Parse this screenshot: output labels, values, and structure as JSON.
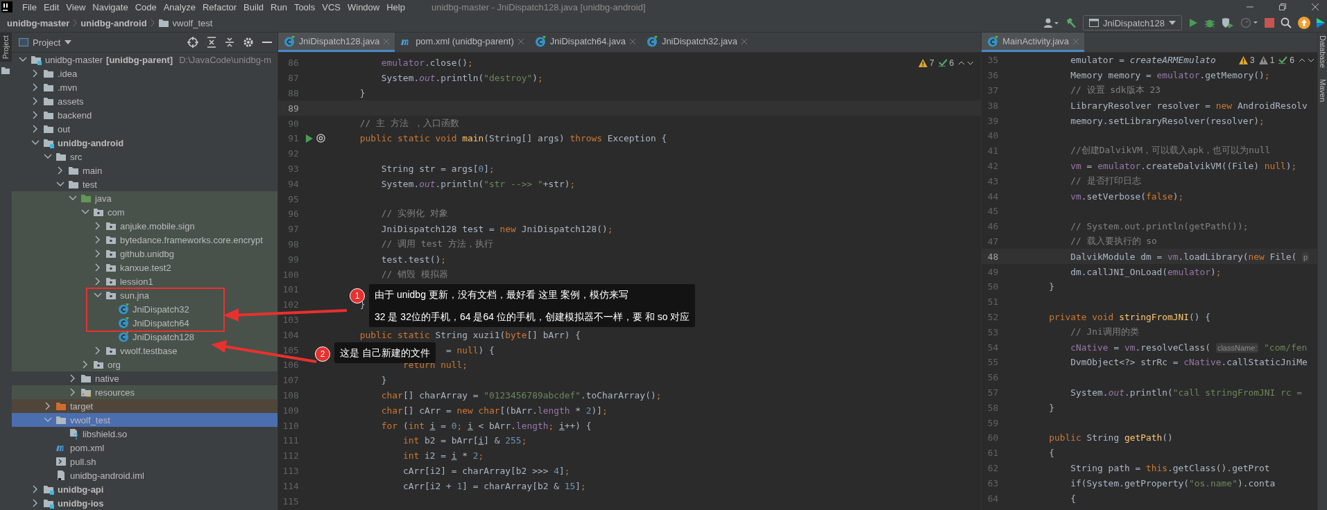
{
  "window": {
    "title": "unidbg-master - JniDispatch128.java [unidbg-android]",
    "menu": [
      "File",
      "Edit",
      "View",
      "Navigate",
      "Code",
      "Analyze",
      "Refactor",
      "Build",
      "Run",
      "Tools",
      "VCS",
      "Window",
      "Help"
    ]
  },
  "breadcrumbs": [
    {
      "label": "unidbg-master",
      "kind": "module"
    },
    {
      "label": "unidbg-android",
      "kind": "module"
    },
    {
      "label": "vwolf_test",
      "kind": "folder"
    }
  ],
  "toolbar": {
    "run_configuration": "JniDispatch128"
  },
  "side_tabs": {
    "left": [
      {
        "label": "Project",
        "selected": true
      }
    ],
    "right": [
      {
        "label": "Database",
        "selected": false
      },
      {
        "label": "Maven",
        "selected": false
      }
    ]
  },
  "project_panel": {
    "title": "Project",
    "tree": [
      {
        "name": "unidbg-master",
        "module_label": "[unidbg-parent]",
        "path": "D:\\JavaCode\\unidbg-m",
        "kind": "module",
        "bold": false,
        "expanded": true,
        "selected": false,
        "children": [
          {
            "name": ".idea",
            "kind": "folder",
            "expanded": false,
            "selected": false
          },
          {
            "name": ".mvn",
            "kind": "folder",
            "expanded": false,
            "selected": false
          },
          {
            "name": "assets",
            "kind": "folder",
            "expanded": false,
            "selected": false
          },
          {
            "name": "backend",
            "kind": "folder",
            "expanded": false,
            "selected": false
          },
          {
            "name": "out",
            "kind": "folder",
            "expanded": false,
            "selected": false
          },
          {
            "name": "unidbg-android",
            "kind": "module",
            "bold": true,
            "expanded": true,
            "selected": false,
            "children": [
              {
                "name": "src",
                "kind": "folder",
                "expanded": true,
                "selected": false,
                "children": [
                  {
                    "name": "main",
                    "kind": "folder",
                    "expanded": false,
                    "selected": false
                  },
                  {
                    "name": "test",
                    "kind": "folder",
                    "expanded": true,
                    "selected": false,
                    "children": [
                      {
                        "name": "java",
                        "kind": "test-source",
                        "expanded": true,
                        "selected": false,
                        "children": [
                          {
                            "name": "com",
                            "kind": "package",
                            "expanded": true,
                            "selected": false,
                            "children": [
                              {
                                "name": "anjuke.mobile.sign",
                                "kind": "package",
                                "expanded": false,
                                "selected": false
                              },
                              {
                                "name": "bytedance.frameworks.core.encrypt",
                                "kind": "package",
                                "expanded": false,
                                "selected": false
                              },
                              {
                                "name": "github.unidbg",
                                "kind": "package",
                                "expanded": false,
                                "selected": false
                              },
                              {
                                "name": "kanxue.test2",
                                "kind": "package",
                                "expanded": false,
                                "selected": false
                              },
                              {
                                "name": "lession1",
                                "kind": "package",
                                "expanded": false,
                                "selected": false
                              },
                              {
                                "name": "sun.jna",
                                "kind": "package",
                                "expanded": true,
                                "selected": false,
                                "children": [
                                  {
                                    "name": "JniDispatch32",
                                    "kind": "class",
                                    "selected": false
                                  },
                                  {
                                    "name": "JniDispatch64",
                                    "kind": "class",
                                    "selected": false
                                  },
                                  {
                                    "name": "JniDispatch128",
                                    "kind": "class",
                                    "selected": false
                                  }
                                ]
                              },
                              {
                                "name": "vwolf.testbase",
                                "kind": "package",
                                "expanded": false,
                                "selected": false
                              }
                            ]
                          },
                          {
                            "name": "org",
                            "kind": "package",
                            "expanded": false,
                            "selected": false
                          }
                        ]
                      },
                      {
                        "name": "native",
                        "kind": "folder",
                        "expanded": false,
                        "selected": false
                      },
                      {
                        "name": "resources",
                        "kind": "resources",
                        "expanded": false,
                        "selected": false
                      }
                    ]
                  }
                ]
              },
              {
                "name": "target",
                "kind": "excluded",
                "expanded": false,
                "selected": false
              },
              {
                "name": "vwolf_test",
                "kind": "folder",
                "expanded": true,
                "selected": true,
                "children": [
                  {
                    "name": "libshield.so",
                    "kind": "unknown-file",
                    "selected": false
                  }
                ]
              },
              {
                "name": "pom.xml",
                "kind": "maven",
                "selected": false
              },
              {
                "name": "pull.sh",
                "kind": "shell",
                "selected": false
              },
              {
                "name": "unidbg-android.iml",
                "kind": "iml",
                "selected": false
              }
            ]
          },
          {
            "name": "unidbg-api",
            "kind": "module",
            "bold": true,
            "expanded": false,
            "selected": false
          },
          {
            "name": "unidbg-ios",
            "kind": "module",
            "bold": true,
            "expanded": false,
            "selected": false
          }
        ]
      }
    ]
  },
  "editors": [
    {
      "tabs": [
        {
          "label": "JniDispatch128.java",
          "kind": "class",
          "selected": true
        },
        {
          "label": "pom.xml (unidbg-parent)",
          "kind": "maven",
          "selected": false
        },
        {
          "label": "JniDispatch64.java",
          "kind": "class",
          "selected": false
        },
        {
          "label": "JniDispatch32.java",
          "kind": "class",
          "selected": false
        }
      ],
      "inspections": [
        {
          "kind": "warning",
          "count": "7"
        },
        {
          "kind": "typo",
          "count": "6"
        }
      ],
      "lines": [
        {
          "n": "86",
          "current": false,
          "tokens": [
            {
              "kind": "field",
              "text": "    emulator"
            },
            {
              "kind": "plain",
              "text": ".close()"
            },
            {
              "kind": "keyword",
              "text": ";"
            }
          ]
        },
        {
          "n": "87",
          "current": false,
          "tokens": [
            {
              "kind": "plain",
              "text": "    System."
            },
            {
              "kind": "static",
              "text": "out"
            },
            {
              "kind": "plain",
              "text": ".println("
            },
            {
              "kind": "string",
              "text": "\"destroy\""
            },
            {
              "kind": "plain",
              "text": ")"
            },
            {
              "kind": "keyword",
              "text": ";"
            }
          ]
        },
        {
          "n": "88",
          "current": false,
          "tokens": [
            {
              "kind": "plain",
              "text": "}"
            }
          ]
        },
        {
          "n": "89",
          "current": true
        },
        {
          "n": "90",
          "current": false,
          "tokens": [
            {
              "kind": "comment",
              "text": "// 主 方法 ，入口函数"
            }
          ]
        },
        {
          "n": "91",
          "current": false,
          "kind": "entry-point",
          "tokens": [
            {
              "kind": "keyword",
              "text": "public static void "
            },
            {
              "kind": "method",
              "text": "main"
            },
            {
              "kind": "plain",
              "text": "(String[] args) "
            },
            {
              "kind": "keyword",
              "text": "throws "
            },
            {
              "kind": "plain",
              "text": "Exception {"
            }
          ]
        },
        {
          "n": "92",
          "current": false
        },
        {
          "n": "93",
          "current": false,
          "tokens": [
            {
              "kind": "plain",
              "text": "    String str = args["
            },
            {
              "kind": "number",
              "text": "0"
            },
            {
              "kind": "plain",
              "text": "]"
            },
            {
              "kind": "keyword",
              "text": ";"
            }
          ]
        },
        {
          "n": "94",
          "current": false,
          "tokens": [
            {
              "kind": "plain",
              "text": "    System."
            },
            {
              "kind": "static",
              "text": "out"
            },
            {
              "kind": "plain",
              "text": ".println("
            },
            {
              "kind": "string",
              "text": "\"str -->> \""
            },
            {
              "kind": "plain",
              "text": "+str)"
            },
            {
              "kind": "keyword",
              "text": ";"
            }
          ]
        },
        {
          "n": "95",
          "current": false
        },
        {
          "n": "96",
          "current": false,
          "tokens": [
            {
              "kind": "comment",
              "text": "    // 实例化 对象"
            }
          ]
        },
        {
          "n": "97",
          "current": false,
          "tokens": [
            {
              "kind": "plain",
              "text": "    JniDispatch128 test = "
            },
            {
              "kind": "keyword",
              "text": "new "
            },
            {
              "kind": "plain",
              "text": "JniDispatch128()"
            },
            {
              "kind": "keyword",
              "text": ";"
            }
          ]
        },
        {
          "n": "98",
          "current": false,
          "tokens": [
            {
              "kind": "comment",
              "text": "    // 调用 test 方法，执行"
            }
          ]
        },
        {
          "n": "99",
          "current": false,
          "tokens": [
            {
              "kind": "plain",
              "text": "    test.test()"
            },
            {
              "kind": "keyword",
              "text": ";"
            }
          ]
        },
        {
          "n": "100",
          "current": false,
          "tokens": [
            {
              "kind": "comment",
              "text": "    // 销毁 模拟器"
            }
          ]
        },
        {
          "n": "101",
          "current": false
        },
        {
          "n": "102",
          "current": false,
          "tokens": [
            {
              "kind": "plain",
              "text": "}"
            }
          ]
        },
        {
          "n": "103",
          "current": false
        },
        {
          "n": "104",
          "current": false,
          "tokens": [
            {
              "kind": "keyword",
              "text": "public static "
            },
            {
              "kind": "plain",
              "text": "String xuzi1("
            },
            {
              "kind": "keyword",
              "text": "byte"
            },
            {
              "kind": "plain",
              "text": "[] bArr) {"
            }
          ]
        },
        {
          "n": "105",
          "current": false,
          "tokens": [
            {
              "kind": "plain",
              "text": "                = "
            },
            {
              "kind": "keyword",
              "text": "null"
            },
            {
              "kind": "plain",
              "text": ") {"
            }
          ]
        },
        {
          "n": "106",
          "current": false,
          "tokens": [
            {
              "kind": "keyword",
              "text": "        return null;"
            }
          ]
        },
        {
          "n": "107",
          "current": false,
          "tokens": [
            {
              "kind": "plain",
              "text": "    }"
            }
          ]
        },
        {
          "n": "108",
          "current": false,
          "tokens": [
            {
              "kind": "keyword",
              "text": "    char"
            },
            {
              "kind": "plain",
              "text": "[] charArray = "
            },
            {
              "kind": "string",
              "text": "\"0123456789abcdef\""
            },
            {
              "kind": "plain",
              "text": ".toCharArray()"
            },
            {
              "kind": "keyword",
              "text": ";"
            }
          ]
        },
        {
          "n": "109",
          "current": false,
          "tokens": [
            {
              "kind": "keyword",
              "text": "    char"
            },
            {
              "kind": "plain",
              "text": "[] cArr = "
            },
            {
              "kind": "keyword",
              "text": "new char"
            },
            {
              "kind": "plain",
              "text": "[(bArr."
            },
            {
              "kind": "field",
              "text": "length"
            },
            {
              "kind": "plain",
              "text": " * "
            },
            {
              "kind": "number",
              "text": "2"
            },
            {
              "kind": "plain",
              "text": ")]"
            },
            {
              "kind": "keyword",
              "text": ";"
            }
          ]
        },
        {
          "n": "110",
          "current": false,
          "tokens": [
            {
              "kind": "keyword",
              "text": "    for "
            },
            {
              "kind": "plain",
              "text": "("
            },
            {
              "kind": "keyword",
              "text": "int "
            },
            {
              "kind": "variable",
              "text": "i"
            },
            {
              "kind": "plain",
              "text": " = "
            },
            {
              "kind": "number",
              "text": "0"
            },
            {
              "kind": "keyword",
              "text": "; "
            },
            {
              "kind": "variable",
              "text": "i"
            },
            {
              "kind": "plain",
              "text": " < bArr."
            },
            {
              "kind": "field",
              "text": "length"
            },
            {
              "kind": "keyword",
              "text": "; "
            },
            {
              "kind": "variable",
              "text": "i"
            },
            {
              "kind": "plain",
              "text": "++) {"
            }
          ]
        },
        {
          "n": "111",
          "current": false,
          "tokens": [
            {
              "kind": "keyword",
              "text": "        int "
            },
            {
              "kind": "plain",
              "text": "b2 = bArr["
            },
            {
              "kind": "variable",
              "text": "i"
            },
            {
              "kind": "plain",
              "text": "] & "
            },
            {
              "kind": "number",
              "text": "255"
            },
            {
              "kind": "keyword",
              "text": ";"
            }
          ]
        },
        {
          "n": "112",
          "current": false,
          "tokens": [
            {
              "kind": "keyword",
              "text": "        int "
            },
            {
              "kind": "plain",
              "text": "i2 = "
            },
            {
              "kind": "variable",
              "text": "i"
            },
            {
              "kind": "plain",
              "text": " * "
            },
            {
              "kind": "number",
              "text": "2"
            },
            {
              "kind": "keyword",
              "text": ";"
            }
          ]
        },
        {
          "n": "113",
          "current": false,
          "tokens": [
            {
              "kind": "plain",
              "text": "        cArr[i2] = charArray[b2 >>> "
            },
            {
              "kind": "number",
              "text": "4"
            },
            {
              "kind": "plain",
              "text": "]"
            },
            {
              "kind": "keyword",
              "text": ";"
            }
          ]
        },
        {
          "n": "114",
          "current": false,
          "tokens": [
            {
              "kind": "plain",
              "text": "        cArr[i2 + "
            },
            {
              "kind": "number",
              "text": "1"
            },
            {
              "kind": "plain",
              "text": "] = charArray[b2 & "
            },
            {
              "kind": "number",
              "text": "15"
            },
            {
              "kind": "plain",
              "text": "]"
            },
            {
              "kind": "keyword",
              "text": ";"
            }
          ]
        },
        {
          "n": "115",
          "current": false
        }
      ]
    },
    {
      "tabs": [
        {
          "label": "MainActivity.java",
          "kind": "class",
          "selected": true
        }
      ],
      "inspections": [
        {
          "kind": "warning",
          "count": "3"
        },
        {
          "kind": "weak-warning",
          "count": "1"
        },
        {
          "kind": "typo",
          "count": "6"
        }
      ],
      "lines": [
        {
          "n": "35",
          "current": false,
          "tokens": [
            {
              "kind": "plain",
              "text": "    emulator = "
            },
            {
              "kind": "italic",
              "text": "createARMEmulato"
            }
          ]
        },
        {
          "n": "36",
          "current": false,
          "tokens": [
            {
              "kind": "plain",
              "text": "    Memory memory = "
            },
            {
              "kind": "field",
              "text": "emulator"
            },
            {
              "kind": "plain",
              "text": ".getMemory()"
            },
            {
              "kind": "keyword",
              "text": ";"
            }
          ]
        },
        {
          "n": "37",
          "current": false,
          "tokens": [
            {
              "kind": "comment",
              "text": "    // 设置 sdk版本 23"
            }
          ]
        },
        {
          "n": "38",
          "current": false,
          "tokens": [
            {
              "kind": "plain",
              "text": "    LibraryResolver resolver = "
            },
            {
              "kind": "keyword",
              "text": "new "
            },
            {
              "kind": "plain",
              "text": "AndroidResolv"
            }
          ]
        },
        {
          "n": "39",
          "current": false,
          "tokens": [
            {
              "kind": "plain",
              "text": "    memory.setLibraryResolver(resolver)"
            },
            {
              "kind": "keyword",
              "text": ";"
            }
          ]
        },
        {
          "n": "40",
          "current": false
        },
        {
          "n": "41",
          "current": false,
          "tokens": [
            {
              "kind": "comment",
              "text": "    //创建DalvikVM，可以载入apk，也可以为null"
            }
          ]
        },
        {
          "n": "42",
          "current": false,
          "tokens": [
            {
              "kind": "field",
              "text": "    vm"
            },
            {
              "kind": "plain",
              "text": " = "
            },
            {
              "kind": "field",
              "text": "emulator"
            },
            {
              "kind": "plain",
              "text": ".createDalvikVM((File) "
            },
            {
              "kind": "keyword",
              "text": "null"
            },
            {
              "kind": "plain",
              "text": ")"
            },
            {
              "kind": "keyword",
              "text": ";"
            }
          ]
        },
        {
          "n": "43",
          "current": false,
          "tokens": [
            {
              "kind": "comment",
              "text": "    // 是否打印日志"
            }
          ]
        },
        {
          "n": "44",
          "current": false,
          "tokens": [
            {
              "kind": "field",
              "text": "    vm"
            },
            {
              "kind": "plain",
              "text": ".setVerbose("
            },
            {
              "kind": "keyword",
              "text": "false"
            },
            {
              "kind": "plain",
              "text": ")"
            },
            {
              "kind": "keyword",
              "text": ";"
            }
          ]
        },
        {
          "n": "45",
          "current": false
        },
        {
          "n": "46",
          "current": false,
          "tokens": [
            {
              "kind": "comment",
              "text": "    // System.out.println(getPath());"
            }
          ]
        },
        {
          "n": "47",
          "current": false,
          "tokens": [
            {
              "kind": "comment",
              "text": "    // 载入要执行的 so"
            }
          ]
        },
        {
          "n": "48",
          "current": true,
          "tokens": [
            {
              "kind": "plain",
              "text": "    DalvikModule dm = "
            },
            {
              "kind": "field",
              "text": "vm"
            },
            {
              "kind": "plain",
              "text": ".loadLibrary("
            },
            {
              "kind": "keyword",
              "text": "new "
            },
            {
              "kind": "plain",
              "text": "File( "
            },
            {
              "kind": "hint",
              "text": "p"
            }
          ]
        },
        {
          "n": "49",
          "current": false,
          "tokens": [
            {
              "kind": "plain",
              "text": "    dm.callJNI_OnLoad("
            },
            {
              "kind": "field",
              "text": "emulator"
            },
            {
              "kind": "plain",
              "text": ")"
            },
            {
              "kind": "keyword",
              "text": ";"
            }
          ]
        },
        {
          "n": "50",
          "current": false,
          "tokens": [
            {
              "kind": "plain",
              "text": "}"
            }
          ]
        },
        {
          "n": "51",
          "current": false
        },
        {
          "n": "52",
          "current": false,
          "tokens": [
            {
              "kind": "keyword",
              "text": "private void "
            },
            {
              "kind": "method",
              "text": "stringFromJNI"
            },
            {
              "kind": "plain",
              "text": "() {"
            }
          ]
        },
        {
          "n": "53",
          "current": false,
          "tokens": [
            {
              "kind": "comment",
              "text": "    // Jni调用的类"
            }
          ]
        },
        {
          "n": "54",
          "current": false,
          "tokens": [
            {
              "kind": "field",
              "text": "    cNative"
            },
            {
              "kind": "plain",
              "text": " = "
            },
            {
              "kind": "field",
              "text": "vm"
            },
            {
              "kind": "plain",
              "text": ".resolveClass( "
            },
            {
              "kind": "hint",
              "text": "className:"
            },
            {
              "kind": "string",
              "text": " \"com/fen"
            }
          ]
        },
        {
          "n": "55",
          "current": false,
          "tokens": [
            {
              "kind": "plain",
              "text": "    DvmObject<?> strRc = "
            },
            {
              "kind": "field",
              "text": "cNative"
            },
            {
              "kind": "plain",
              "text": ".callStaticJniMe"
            }
          ]
        },
        {
          "n": "56",
          "current": false
        },
        {
          "n": "57",
          "current": false,
          "tokens": [
            {
              "kind": "plain",
              "text": "    System."
            },
            {
              "kind": "static",
              "text": "out"
            },
            {
              "kind": "plain",
              "text": ".println("
            },
            {
              "kind": "string",
              "text": "\"call stringFromJNI rc ="
            }
          ]
        },
        {
          "n": "58",
          "current": false,
          "tokens": [
            {
              "kind": "plain",
              "text": "}"
            }
          ]
        },
        {
          "n": "59",
          "current": false
        },
        {
          "n": "60",
          "current": false,
          "tokens": [
            {
              "kind": "keyword",
              "text": "public "
            },
            {
              "kind": "plain",
              "text": "String "
            },
            {
              "kind": "method",
              "text": "getPath"
            },
            {
              "kind": "plain",
              "text": "()"
            }
          ]
        },
        {
          "n": "61",
          "current": false,
          "tokens": [
            {
              "kind": "plain",
              "text": "{"
            }
          ]
        },
        {
          "n": "62",
          "current": false,
          "tokens": [
            {
              "kind": "plain",
              "text": "    String path = "
            },
            {
              "kind": "keyword",
              "text": "this"
            },
            {
              "kind": "plain",
              "text": ".getClass().getProt"
            }
          ]
        },
        {
          "n": "63",
          "current": false,
          "tokens": [
            {
              "kind": "plain",
              "text": "    if(System.getProperty("
            },
            {
              "kind": "string",
              "text": "\"os.name\""
            },
            {
              "kind": "plain",
              "text": ").conta"
            }
          ]
        },
        {
          "n": "64",
          "current": false,
          "tokens": [
            {
              "kind": "plain",
              "text": "    {"
            }
          ]
        }
      ]
    }
  ],
  "annotations": [
    {
      "number": "1",
      "lines": [
        "由于 unidbg 更新，没有文档，最好看 这里 案例，模仿来写",
        "32 是 32位的手机，64 是64 位的手机，创建模拟器不一样，要 和  so 对应"
      ]
    },
    {
      "number": "2",
      "lines": [
        "这是 自己新建的文件"
      ]
    }
  ]
}
